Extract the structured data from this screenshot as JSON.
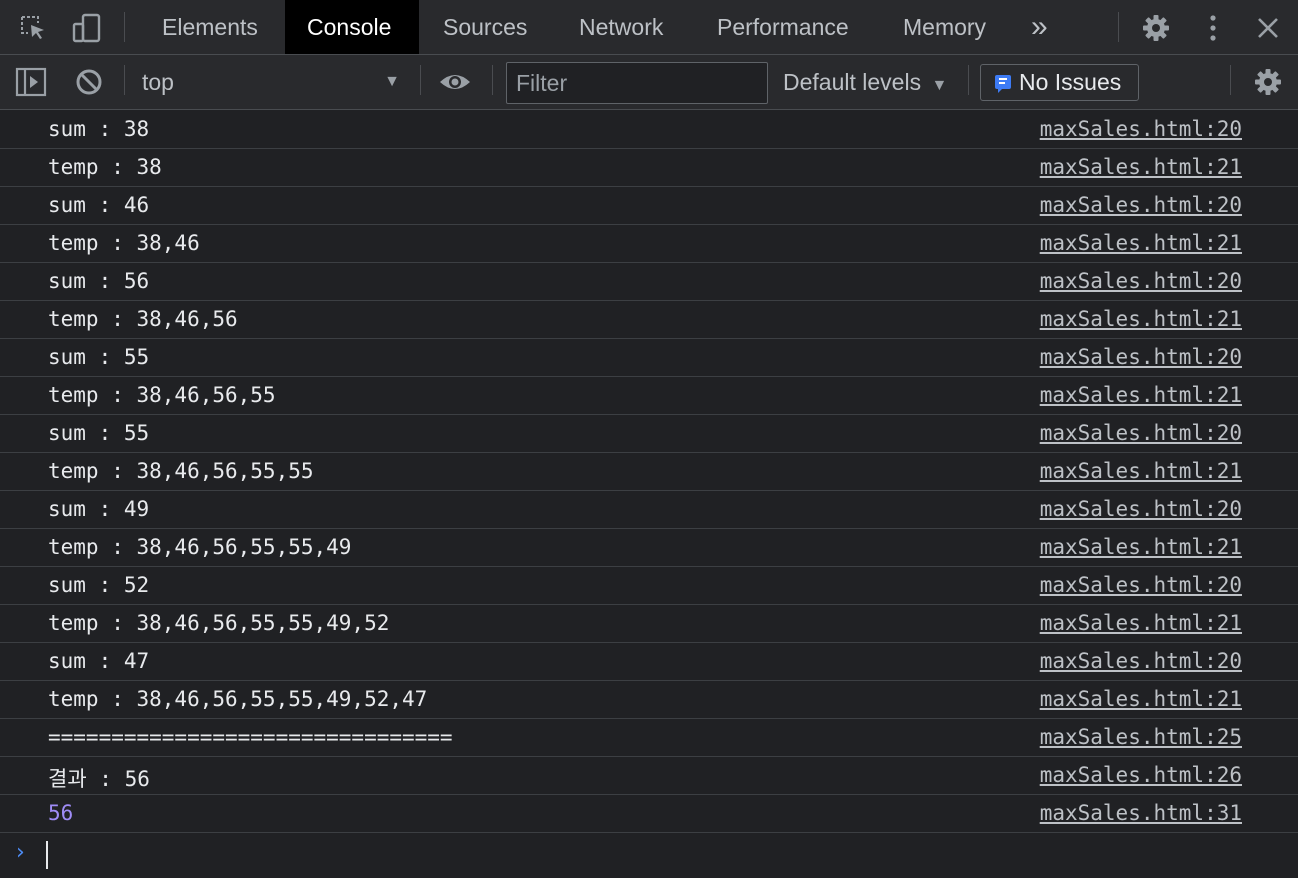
{
  "tabs": [
    {
      "label": "Elements",
      "active": false
    },
    {
      "label": "Console",
      "active": true
    },
    {
      "label": "Sources",
      "active": false
    },
    {
      "label": "Network",
      "active": false
    },
    {
      "label": "Performance",
      "active": false
    },
    {
      "label": "Memory",
      "active": false
    }
  ],
  "icons": {
    "inspect": "inspect-element-icon",
    "device": "device-toolbar-icon",
    "more_tabs": "chevron-double-right-icon",
    "settings": "gear-icon",
    "kebab": "vertical-dots-icon",
    "close": "close-icon",
    "sidebar": "sidebar-toggle-icon",
    "clear": "clear-console-icon",
    "eye": "live-expression-eye-icon",
    "issues": "message-icon"
  },
  "more_tabs_label": "»",
  "toolbar": {
    "context": "top",
    "filter_placeholder": "Filter",
    "levels_label": "Default levels",
    "issues_label": "No Issues"
  },
  "colors": {
    "background": "#202124",
    "toolbar": "#292a2d",
    "active_tab": "#000000",
    "number": "#9f8cf7",
    "prompt": "#4d8cf5"
  },
  "console": {
    "rows": [
      {
        "text": "sum : 38",
        "source": "maxSales.html:20"
      },
      {
        "text": "temp : 38",
        "source": "maxSales.html:21"
      },
      {
        "text": "sum : 46",
        "source": "maxSales.html:20"
      },
      {
        "text": "temp : 38,46",
        "source": "maxSales.html:21"
      },
      {
        "text": "sum : 56",
        "source": "maxSales.html:20"
      },
      {
        "text": "temp : 38,46,56",
        "source": "maxSales.html:21"
      },
      {
        "text": "sum : 55",
        "source": "maxSales.html:20"
      },
      {
        "text": "temp : 38,46,56,55",
        "source": "maxSales.html:21"
      },
      {
        "text": "sum : 55",
        "source": "maxSales.html:20"
      },
      {
        "text": "temp : 38,46,56,55,55",
        "source": "maxSales.html:21"
      },
      {
        "text": "sum : 49",
        "source": "maxSales.html:20"
      },
      {
        "text": "temp : 38,46,56,55,55,49",
        "source": "maxSales.html:21"
      },
      {
        "text": "sum : 52",
        "source": "maxSales.html:20"
      },
      {
        "text": "temp : 38,46,56,55,55,49,52",
        "source": "maxSales.html:21"
      },
      {
        "text": "sum : 47",
        "source": "maxSales.html:20"
      },
      {
        "text": "temp : 38,46,56,55,55,49,52,47",
        "source": "maxSales.html:21"
      },
      {
        "text": "================================",
        "source": "maxSales.html:25"
      },
      {
        "text": "결과 : 56",
        "source": "maxSales.html:26"
      },
      {
        "text": "56",
        "source": "maxSales.html:31",
        "number": true
      }
    ],
    "prompt_value": ""
  }
}
